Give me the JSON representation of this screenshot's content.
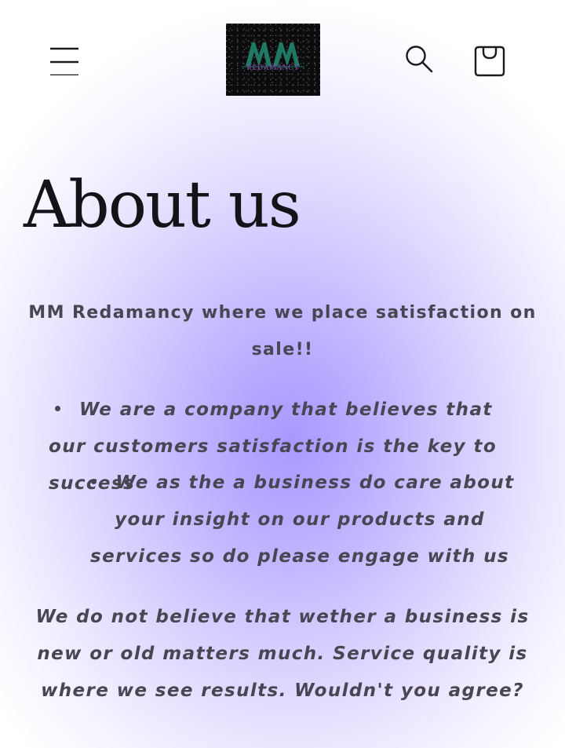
{
  "header": {
    "menu_icon": "hamburger-menu-icon",
    "logo": {
      "mark": "MM",
      "text": "REDAMANCY",
      "colors": {
        "mark": "#1f7a64",
        "text": "#8a4fb0",
        "background": "#0c0c0e"
      }
    },
    "search_icon": "search-icon",
    "cart_icon": "shopping-bag-icon"
  },
  "page": {
    "title": "About us",
    "intro": "MM Redamancy where we place satisfaction on sale!!",
    "bullets": [
      "We are a company that believes that our customers satisfaction is the key to success",
      "We as the a business do care about your insight on our products and services so do please engage with us"
    ],
    "closing": "We do not believe that wether  a business is new or old matters much. Service quality is where we see results.  Wouldn't you agree?"
  },
  "colors": {
    "gradient_center": "#a898ff",
    "text": "#4a4552",
    "title": "#141418"
  }
}
